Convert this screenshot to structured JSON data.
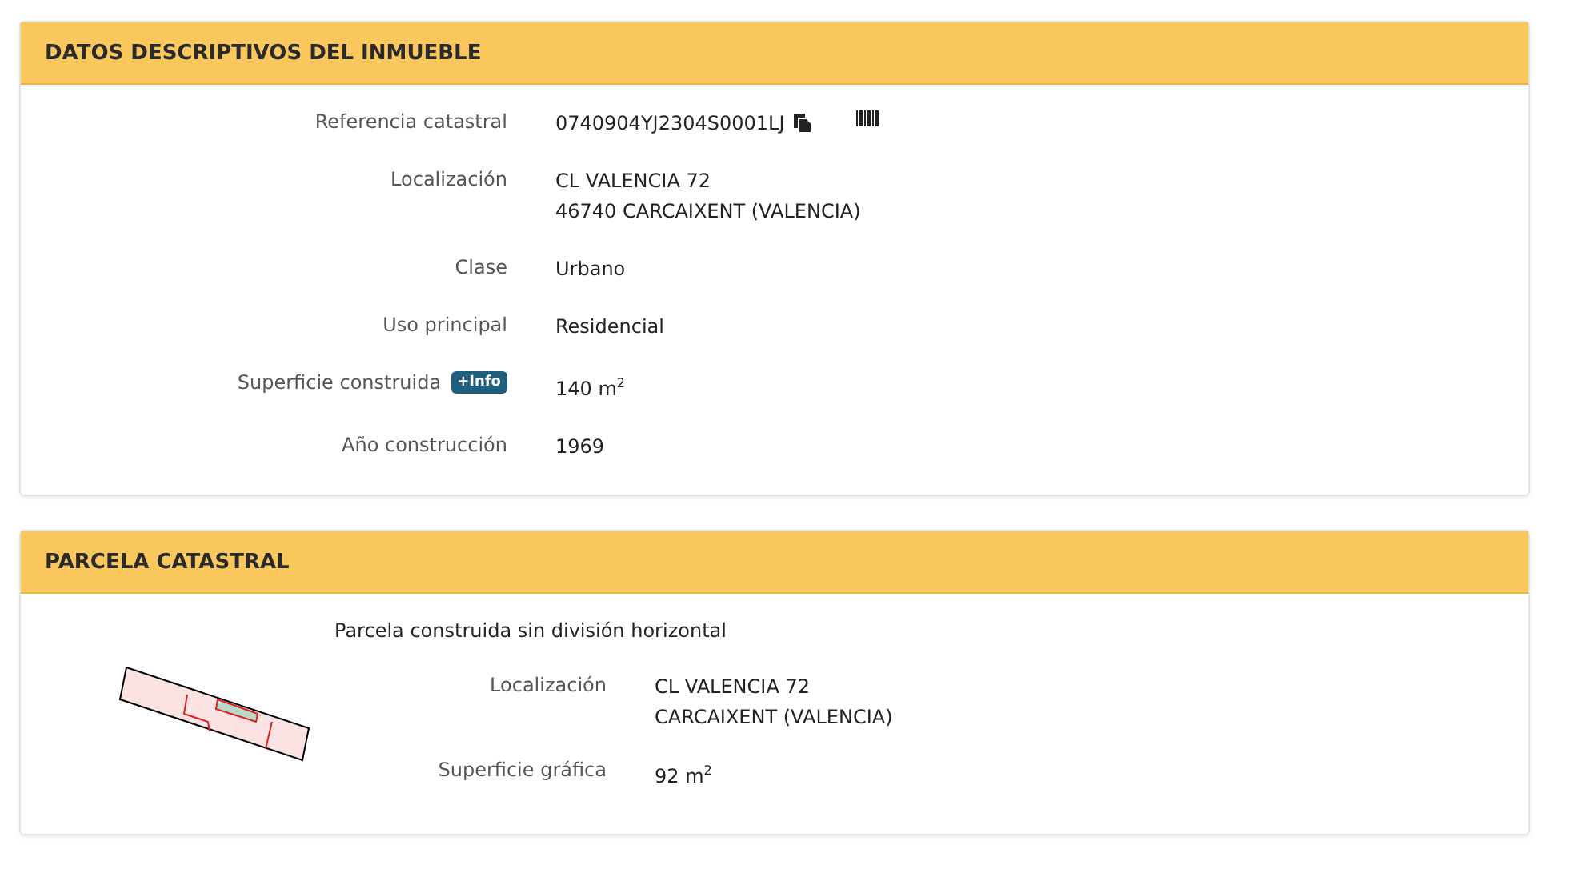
{
  "sections": [
    {
      "title": "DATOS DESCRIPTIVOS DEL INMUEBLE",
      "kind": "details",
      "rows": [
        {
          "label": "Referencia catastral",
          "value": [
            "0740904YJ2304S0001LJ"
          ],
          "actions": true
        },
        {
          "label": "Localización",
          "value": [
            "CL VALENCIA 72",
            "46740 CARCAIXENT (VALENCIA)"
          ]
        },
        {
          "label": "Clase",
          "value": [
            "Urbano"
          ]
        },
        {
          "label": "Uso principal",
          "value": [
            "Residencial"
          ]
        },
        {
          "label": "Superficie construida",
          "badge": "+Info",
          "value": [
            "140 m$^{2}$"
          ]
        },
        {
          "label": "Año construcción",
          "value": [
            "1969"
          ]
        }
      ]
    },
    {
      "title": "PARCELA CATASTRAL",
      "kind": "parcel",
      "note": "Parcela construida sin división horizontal",
      "rows": [
        {
          "label": "Localización",
          "value": [
            "CL VALENCIA 72",
            "CARCAIXENT (VALENCIA)"
          ]
        },
        {
          "label": "Superficie gráfica",
          "value": [
            "92 m$^{2}$"
          ]
        }
      ]
    }
  ]
}
